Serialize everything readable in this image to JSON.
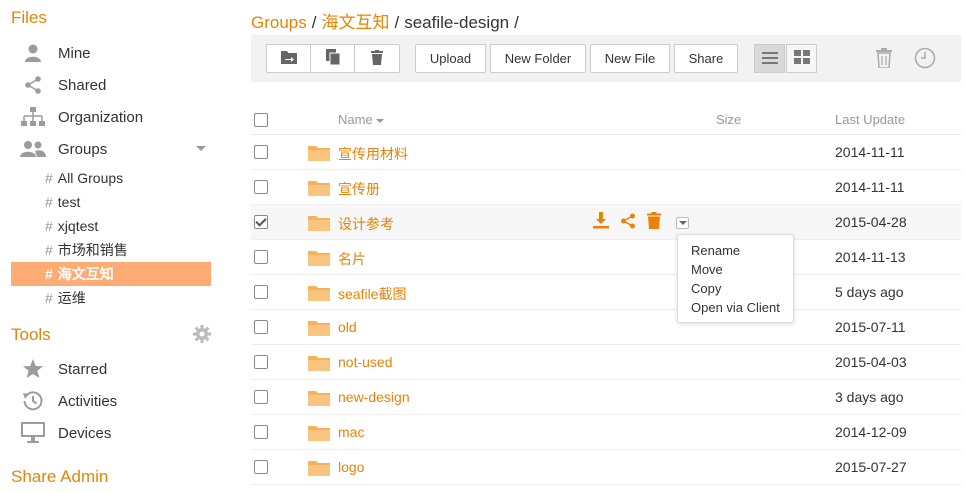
{
  "colors": {
    "accent": "#eb8205",
    "active_group_bg": "#feac74",
    "icon_gray": "#9c9c9c"
  },
  "sidebar": {
    "files_title": "Files",
    "items": [
      {
        "label": "Mine",
        "icon": "user-icon"
      },
      {
        "label": "Shared",
        "icon": "share-icon"
      },
      {
        "label": "Organization",
        "icon": "organization-icon"
      },
      {
        "label": "Groups",
        "icon": "group-icon"
      }
    ],
    "groups": [
      {
        "hash": "#",
        "label": "All Groups"
      },
      {
        "hash": "#",
        "label": "test"
      },
      {
        "hash": "#",
        "label": "xjqtest"
      },
      {
        "hash": "#",
        "label": "市场和销售"
      },
      {
        "hash": "#",
        "label": "海文互知",
        "active": true
      },
      {
        "hash": "#",
        "label": "运维"
      }
    ],
    "tools_title": "Tools",
    "tools": [
      {
        "label": "Starred",
        "icon": "star-icon"
      },
      {
        "label": "Activities",
        "icon": "history-icon"
      },
      {
        "label": "Devices",
        "icon": "monitor-icon"
      }
    ],
    "share_admin_title": "Share Admin"
  },
  "breadcrumb": {
    "groups": "Groups",
    "sep": "/",
    "group": "海文互知",
    "repo": "seafile-design",
    "tail": "/"
  },
  "toolbar": {
    "upload": "Upload",
    "new_folder": "New Folder",
    "new_file": "New File",
    "share": "Share"
  },
  "table": {
    "headers": {
      "name": "Name",
      "size": "Size",
      "last_update": "Last Update"
    },
    "rows": [
      {
        "name": "宣传用材料",
        "updated": "2014-11-11",
        "checked": false
      },
      {
        "name": "宣传册",
        "updated": "2014-11-11",
        "checked": false
      },
      {
        "name": "设计参考",
        "updated": "2015-04-28",
        "checked": true
      },
      {
        "name": "名片",
        "updated": "2014-11-13",
        "checked": false
      },
      {
        "name": "seafile截图",
        "updated": "5 days ago",
        "checked": false
      },
      {
        "name": "old",
        "updated": "2015-07-11",
        "checked": false
      },
      {
        "name": "not-used",
        "updated": "2015-04-03",
        "checked": false
      },
      {
        "name": "new-design",
        "updated": "3 days ago",
        "checked": false
      },
      {
        "name": "mac",
        "updated": "2014-12-09",
        "checked": false
      },
      {
        "name": "logo",
        "updated": "2015-07-27",
        "checked": false
      }
    ]
  },
  "context_menu": {
    "items": [
      "Rename",
      "Move",
      "Copy",
      "Open via Client"
    ]
  }
}
